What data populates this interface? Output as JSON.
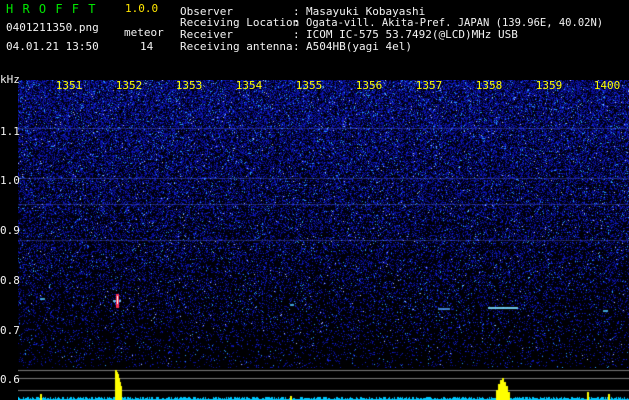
{
  "header": {
    "title": "H R O F F T",
    "version": "1.0.0",
    "filename": "0401211350.png",
    "datetime": "04.01.21 13:50",
    "meteor_label": "meteor",
    "meteor_count": "14"
  },
  "info": [
    {
      "key": "Observer",
      "value": "Masayuki Kobayashi"
    },
    {
      "key": "Receiving Location",
      "value": "Ogata-vill. Akita-Pref. JAPAN (139.96E, 40.02N)"
    },
    {
      "key": "Receiver",
      "value": "ICOM IC-575 53.7492(@LCD)MHz USB"
    },
    {
      "key": "Receiving antenna",
      "value": "A504HB(yagi 4el)"
    }
  ],
  "axis": {
    "y_unit": "kHz",
    "y_ticks": [
      "1.1",
      "1.0",
      "0.9",
      "0.8",
      "0.7",
      "0.6"
    ],
    "x_ticks": [
      "1351",
      "1352",
      "1353",
      "1354",
      "1355",
      "1356",
      "1357",
      "1358",
      "1359",
      "1400"
    ]
  },
  "colors": {
    "background": "#000000",
    "waterfall_base": "#0a0a5a",
    "signal_cyan": "#00c8ff",
    "meteor_yellow": "#ffff00",
    "title_green": "#00e600",
    "tick_yellow": "#ffff00"
  }
}
